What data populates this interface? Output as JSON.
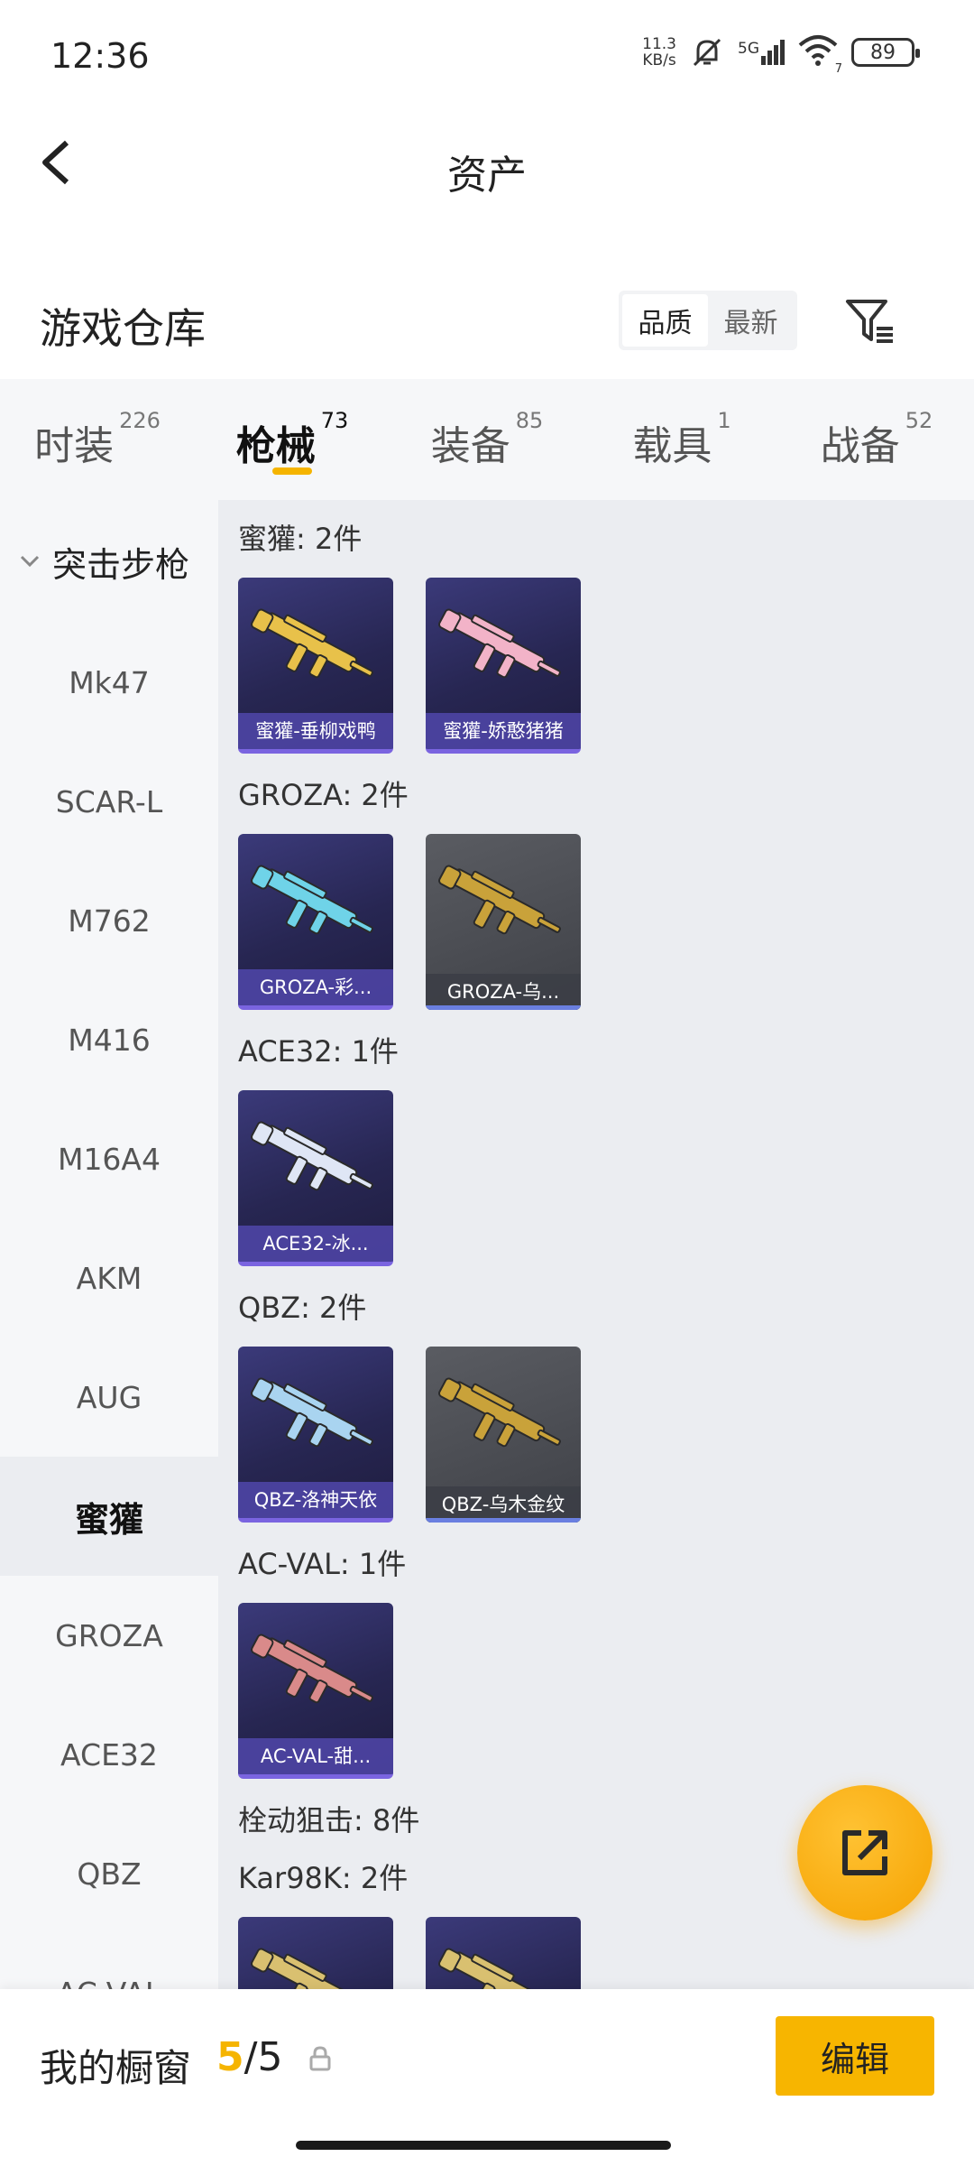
{
  "status": {
    "time": "12:36",
    "net_speed_value": "11.3",
    "net_speed_unit": "KB/s",
    "network": "5G",
    "wifi_level": "7",
    "battery": "89"
  },
  "header": {
    "title": "资产"
  },
  "section": {
    "label": "游戏仓库",
    "sort_options": [
      "品质",
      "最新"
    ],
    "active_sort": "品质"
  },
  "tabs": [
    {
      "label": "时装",
      "count": "226"
    },
    {
      "label": "枪械",
      "count": "73"
    },
    {
      "label": "装备",
      "count": "85"
    },
    {
      "label": "载具",
      "count": "1"
    },
    {
      "label": "战备",
      "count": "52"
    }
  ],
  "active_tab": "枪械",
  "sidebar": {
    "category": "突击步枪",
    "items": [
      "Mk47",
      "SCAR-L",
      "M762",
      "M416",
      "M16A4",
      "AKM",
      "AUG",
      "蜜獾",
      "GROZA",
      "ACE32",
      "QBZ",
      "AC-VAL"
    ],
    "active": "蜜獾"
  },
  "groups": [
    {
      "title": "蜜獾: 2件",
      "items": [
        {
          "caption": "蜜獾-垂柳戏鸭",
          "icon": "gold-smg-icon",
          "color": "#e8c14a",
          "style": "purple"
        },
        {
          "caption": "蜜獾-娇憨猪猪",
          "icon": "pink-smg-icon",
          "color": "#f2b3c8",
          "style": "purple"
        }
      ]
    },
    {
      "title": "GROZA: 2件",
      "items": [
        {
          "caption": "GROZA-彩...",
          "icon": "rainbow-bullpup-icon",
          "color": "#6fd3e8",
          "style": "purple"
        },
        {
          "caption": "GROZA-乌...",
          "icon": "black-gold-bullpup-icon",
          "color": "#c9a23a",
          "style": "gray"
        }
      ]
    },
    {
      "title": "ACE32: 1件",
      "items": [
        {
          "caption": "ACE32-冰...",
          "icon": "ice-rifle-icon",
          "color": "#dfe6f5",
          "style": "purple"
        }
      ]
    },
    {
      "title": "QBZ: 2件",
      "items": [
        {
          "caption": "QBZ-洛神天依",
          "icon": "blue-rifle-icon",
          "color": "#a9d4f0",
          "style": "purple"
        },
        {
          "caption": "QBZ-乌木金纹",
          "icon": "black-gold-rifle-icon",
          "color": "#c9a23a",
          "style": "gray"
        }
      ]
    },
    {
      "title": "AC-VAL: 1件",
      "items": [
        {
          "caption": "AC-VAL-甜...",
          "icon": "pink-rifle-icon",
          "color": "#d98a8a",
          "style": "purple"
        }
      ]
    },
    {
      "title": "栓动狙击: 8件",
      "items": []
    },
    {
      "title": "Kar98K: 2件",
      "items": [
        {
          "caption": "",
          "icon": "sniper-icon",
          "color": "#d9c070",
          "style": "purple"
        },
        {
          "caption": "",
          "icon": "sniper-icon",
          "color": "#d9c070",
          "style": "purple"
        }
      ]
    }
  ],
  "bottom": {
    "label": "我的橱窗",
    "current": "5",
    "separator": "/",
    "total": "5",
    "edit": "编辑"
  }
}
